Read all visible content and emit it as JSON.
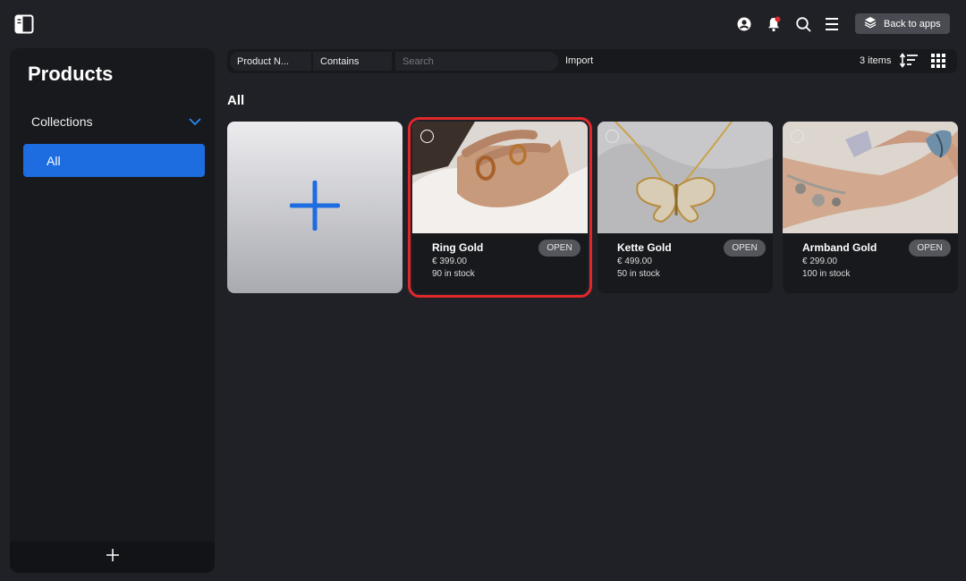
{
  "topbar": {
    "back_label": "Back to apps",
    "icons": [
      "sidebar-toggle-icon",
      "account-icon",
      "notification-bell-icon",
      "search-icon",
      "menu-icon",
      "layers-icon"
    ],
    "notification_dot_color": "#e0282b"
  },
  "sidebar": {
    "title": "Products",
    "collections_label": "Collections",
    "items": [
      {
        "label": "All",
        "active": true
      }
    ],
    "accent_color": "#1d6ce0"
  },
  "filter": {
    "field_label": "Product N...",
    "operator_label": "Contains",
    "search_placeholder": "Search",
    "import_label": "Import",
    "count_label": "3 items"
  },
  "main": {
    "section_title": "All",
    "add_tile_icon": "plus-icon",
    "products": [
      {
        "name": "Ring Gold",
        "price": "€ 399.00",
        "stock": "90 in stock",
        "action": "OPEN",
        "selected": true
      },
      {
        "name": "Kette Gold",
        "price": "€ 499.00",
        "stock": "50 in stock",
        "action": "OPEN",
        "selected": false
      },
      {
        "name": "Armband Gold",
        "price": "€ 299.00",
        "stock": "100 in stock",
        "action": "OPEN",
        "selected": false
      }
    ]
  }
}
